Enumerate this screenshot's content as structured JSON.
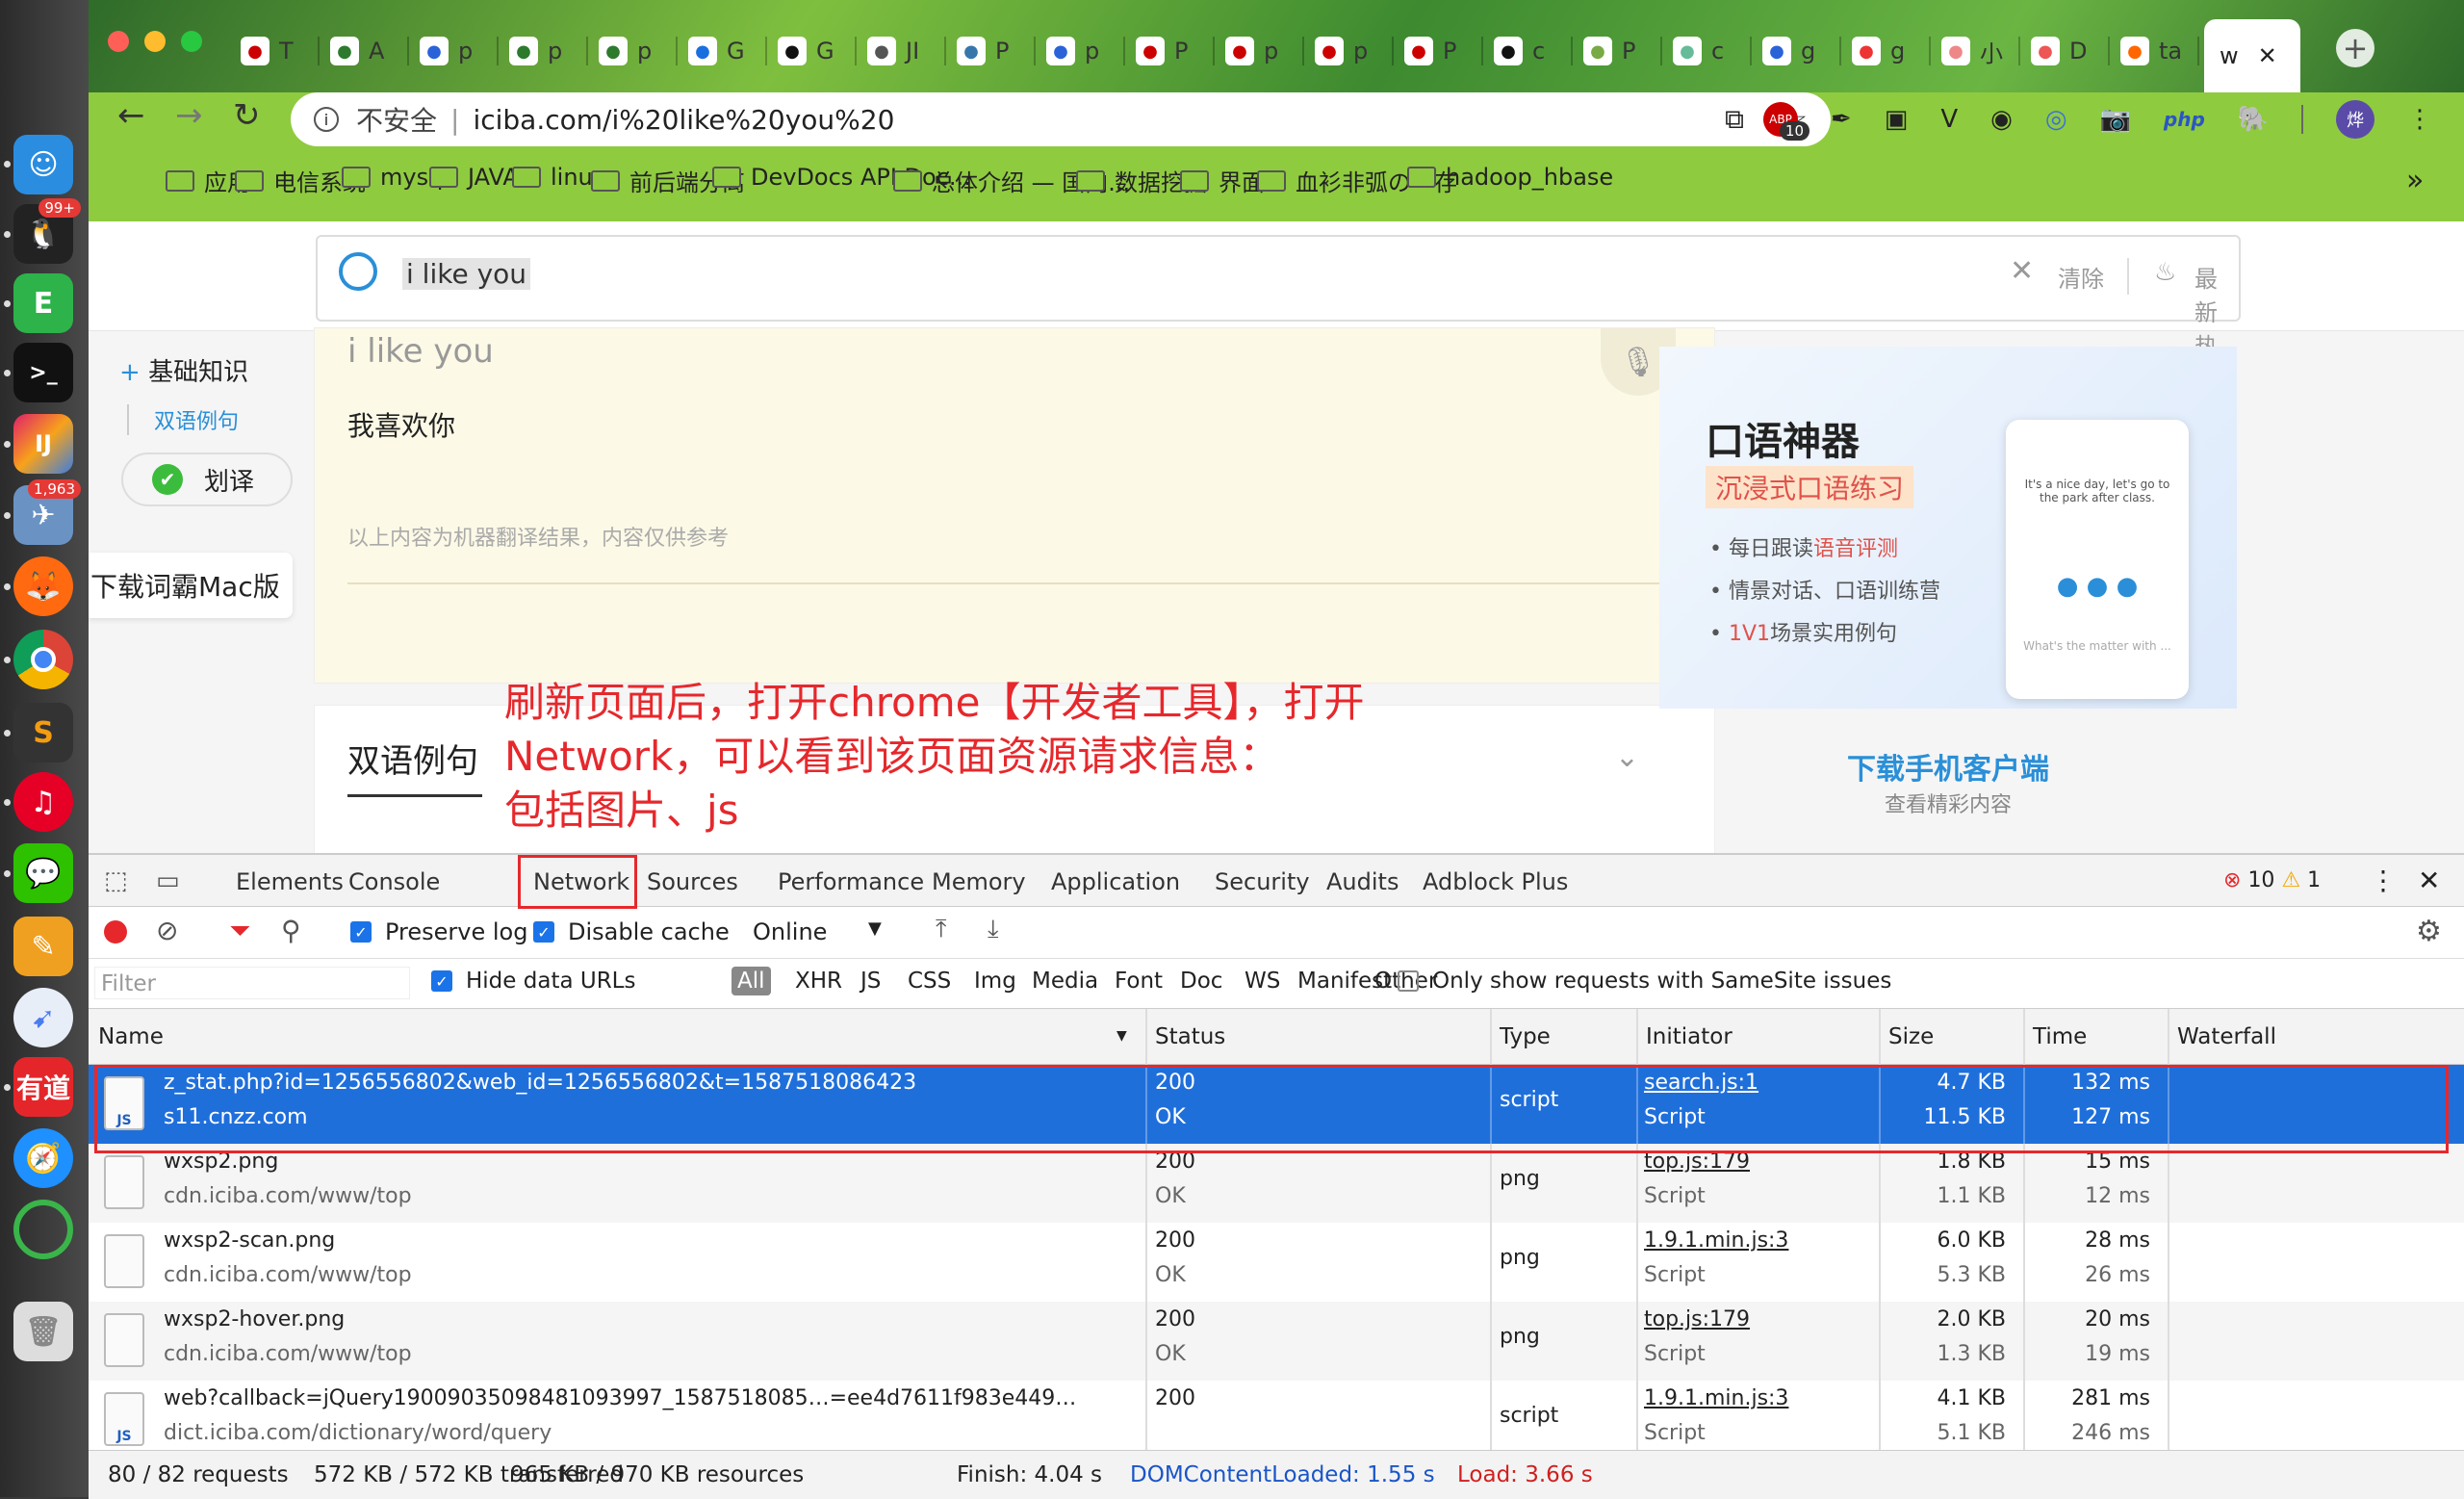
{
  "dock": {
    "badges": {
      "qq": "99+",
      "mail": "1,963"
    },
    "youdao_label": "有道"
  },
  "browser": {
    "tabs": [
      "T",
      "A",
      "p",
      "p",
      "p",
      "G",
      "G",
      "JI",
      "P",
      "p",
      "P",
      "p",
      "p",
      "P",
      "c",
      "P",
      "c",
      "g",
      "g",
      "小",
      "D",
      "ta"
    ],
    "active_tab": "w",
    "url_insecure": "不安全",
    "url": "iciba.com/i%20like%20you%20",
    "ext_count": "10",
    "php_label": "php",
    "bookmarks": [
      "应用",
      "电信系统",
      "mysql",
      "JAVA",
      "linux",
      "前后端分离",
      "DevDocs API Doc...",
      "总体介绍 — 国内...",
      "数据挖掘",
      "界面",
      "血衫非弧の一存",
      "hadoop_hbase"
    ],
    "more": "»"
  },
  "page": {
    "search_value": "i like you",
    "clear": "清除",
    "hot": "最新热词",
    "left_nav": {
      "basic": "基础知识",
      "bilingual": "双语例句",
      "translate": "划译",
      "mac": "下载词霸Mac版"
    },
    "word": "i like you",
    "translation": "我喜欢你",
    "note": "以上内容为机器翻译结果，内容仅供参考",
    "section2": "双语例句",
    "ad": {
      "title": "口语神器",
      "subtitle": "沉浸式口语练习",
      "b1": "每日跟读",
      "b1red": "语音评测",
      "b2": "情景对话、口语训练营",
      "b3red": "1V1",
      "b3": "场景实用例句",
      "phone_text": "It's a nice day, let's go to the park after class.",
      "phone_q": "What's the matter with ...",
      "dl": "下载手机客户端",
      "dl_sub": "查看精彩内容"
    },
    "annotation": [
      "刷新页面后，打开chrome【开发者工具】，打开",
      "Network，可以看到该页面资源请求信息：",
      "包括图片、js"
    ]
  },
  "devtools": {
    "tabs": [
      "Elements",
      "Console",
      "Network",
      "Sources",
      "Performance",
      "Memory",
      "Application",
      "Security",
      "Audits",
      "Adblock Plus"
    ],
    "errors": "10",
    "warnings": "1",
    "preserve_log": "Preserve log",
    "disable_cache": "Disable cache",
    "throttle": "Online",
    "filter_placeholder": "Filter",
    "hide_data_urls": "Hide data URLs",
    "types": [
      "All",
      "XHR",
      "JS",
      "CSS",
      "Img",
      "Media",
      "Font",
      "Doc",
      "WS",
      "Manifest",
      "Other"
    ],
    "samesite": "Only show requests with SameSite issues",
    "columns": [
      "Name",
      "Status",
      "Type",
      "Initiator",
      "Size",
      "Time",
      "Waterfall"
    ],
    "rows": [
      {
        "name": "z_stat.php?id=1256556802&web_id=1256556802&t=1587518086423",
        "domain": "s11.cnzz.com",
        "status": "200",
        "status_text": "OK",
        "type": "script",
        "initiator": "search.js:1",
        "init_type": "Script",
        "size1": "4.7 KB",
        "size2": "11.5 KB",
        "time1": "132 ms",
        "time2": "127 ms",
        "icon": "JS"
      },
      {
        "name": "wxsp2.png",
        "domain": "cdn.iciba.com/www/top",
        "status": "200",
        "status_text": "OK",
        "type": "png",
        "initiator": "top.js:179",
        "init_type": "Script",
        "size1": "1.8 KB",
        "size2": "1.1 KB",
        "time1": "15 ms",
        "time2": "12 ms",
        "icon": ""
      },
      {
        "name": "wxsp2-scan.png",
        "domain": "cdn.iciba.com/www/top",
        "status": "200",
        "status_text": "OK",
        "type": "png",
        "initiator": "1.9.1.min.js:3",
        "init_type": "Script",
        "size1": "6.0 KB",
        "size2": "5.3 KB",
        "time1": "28 ms",
        "time2": "26 ms",
        "icon": ""
      },
      {
        "name": "wxsp2-hover.png",
        "domain": "cdn.iciba.com/www/top",
        "status": "200",
        "status_text": "OK",
        "type": "png",
        "initiator": "top.js:179",
        "init_type": "Script",
        "size1": "2.0 KB",
        "size2": "1.3 KB",
        "time1": "20 ms",
        "time2": "19 ms",
        "icon": ""
      },
      {
        "name": "web?callback=jQuery19009035098481093997_1587518085…=ee4d7611f983e449…",
        "domain": "dict.iciba.com/dictionary/word/query",
        "status": "200",
        "status_text": "",
        "type": "script",
        "initiator": "1.9.1.min.js:3",
        "init_type": "Script",
        "size1": "4.1 KB",
        "size2": "5.1 KB",
        "time1": "281 ms",
        "time2": "246 ms",
        "icon": "JS"
      }
    ],
    "status": {
      "requests": "80 / 82 requests",
      "transferred": "572 KB / 572 KB transferred",
      "resources": "965 KB / 970 KB resources",
      "finish": "Finish: 4.04 s",
      "dcl": "DOMContentLoaded: 1.55 s",
      "load": "Load: 3.66 s"
    }
  }
}
